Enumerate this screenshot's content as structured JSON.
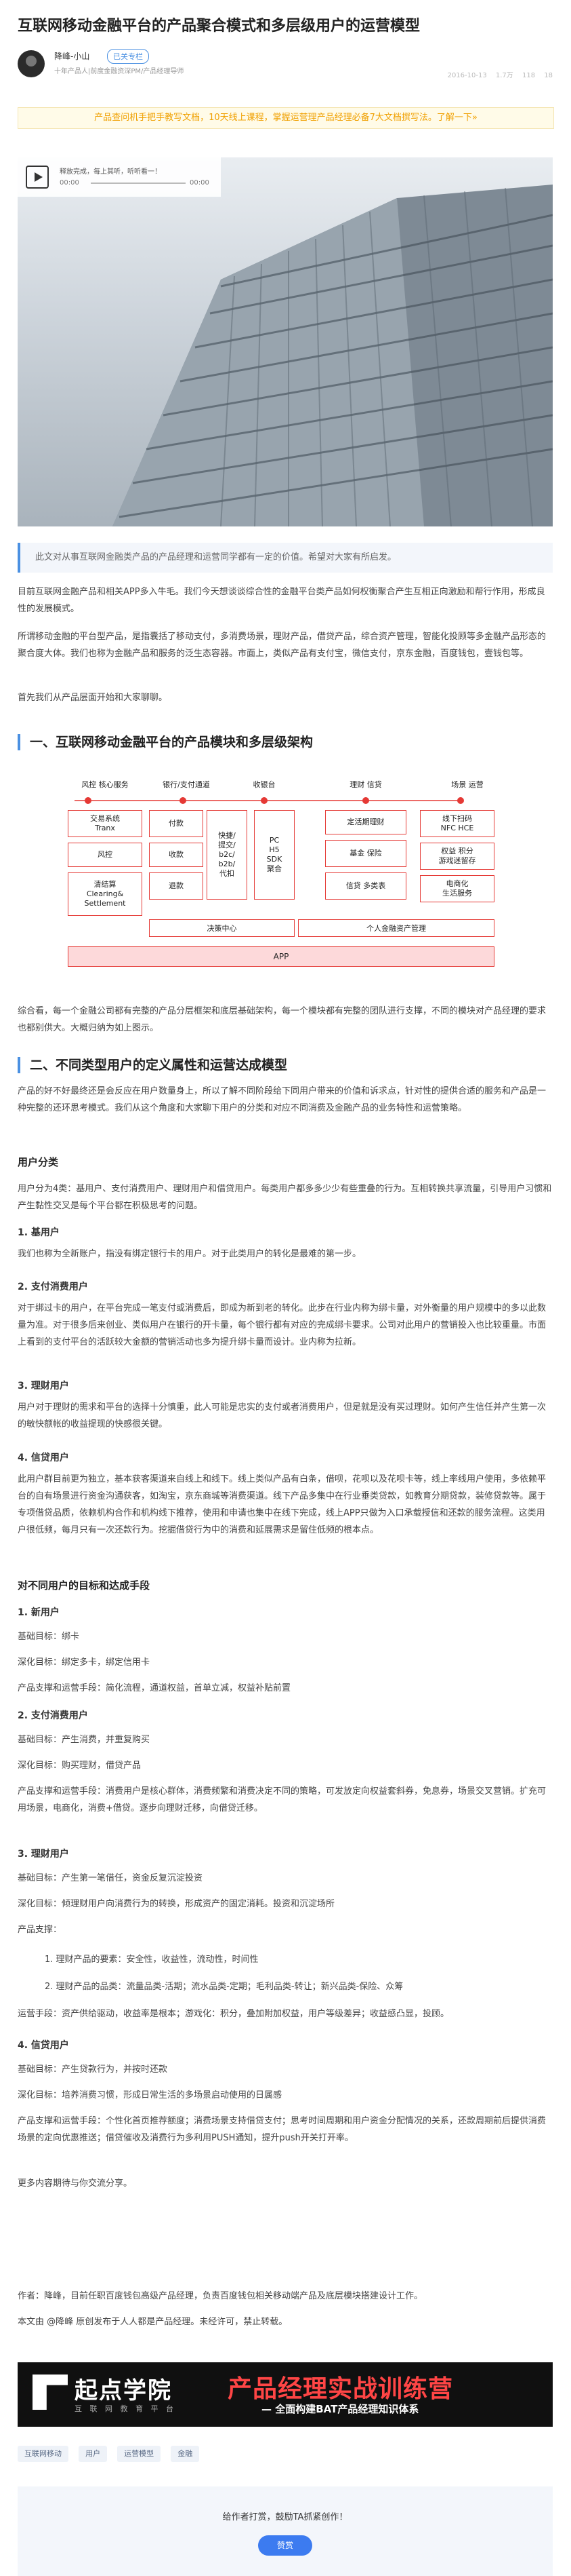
{
  "article": {
    "title": "互联网移动金融平台的产品聚合模式和多层级用户的运营模型",
    "author": "降峰-小山",
    "follow_label": "已关专栏",
    "author_desc": "十年产品人|前度金融资深PM/产品经理导师",
    "date": "2016-10-13",
    "views": "1.7万",
    "likes": "118",
    "comments": "18"
  },
  "notice": "产品查问机手把手教写文档，10天线上课程，掌握运营理产品经理必备7大文档撰写法。了解一下»",
  "audio": {
    "title": "释放完成，每上其听，听听看一！",
    "time_start": "00:00",
    "time_end": "00:00"
  },
  "summary": "此文对从事互联网金融类产品的产品经理和运营同学都有一定的价值。希望对大家有所启发。",
  "intro": [
    "目前互联网金融产品和相关APP多入牛毛。我们今天想谈谈综合性的金融平台类产品如何权衡聚合产生互相正向激励和帮行作用，形成良性的发展模式。",
    "所谓移动金融的平台型产品，是指囊括了移动支付，多消费场景，理财产品，借贷产品，综合资产管理，智能化投顾等多金融产品形态的聚合度大体。我们也称为金融产品和服务的泛生态容器。市面上，类似产品有支付宝，微信支付，京东金融，百度钱包，壹钱包等。",
    "首先我们从产品层面开始和大家聊聊。"
  ],
  "section1": {
    "heading": "一、互联网移动金融平台的产品模块和多层级架构",
    "diagram": {
      "top_labels": [
        "风控 核心服务",
        "银行/支付通道",
        "收银台",
        "理财 信贷",
        "场景 运营"
      ],
      "col1": [
        "交易系统\nTranx",
        "风控",
        "清结算\nClearing&\nSettlement"
      ],
      "col2": [
        "付款",
        "收款",
        "退款"
      ],
      "col3": "快捷/\n提交/\nb2c/\nb2b/\n代扣",
      "col4": "PC\nH5\nSDK\n聚合",
      "col5": [
        "定活期理财",
        "基金 保险",
        "信贷 多类表"
      ],
      "col6": [
        "线下扫码\nNFC HCE",
        "权益 积分\n游戏迷留存",
        "电商化\n生活服务"
      ],
      "bar_left": "决策中心",
      "bar_right": "个人金融资产管理",
      "app": "APP"
    },
    "after": "综合看，每一个金融公司都有完整的产品分层框架和底层基础架构，每一个模块都有完整的团队进行支撑，不同的模块对产品经理的要求也都别供大。大概归纳为如上图示。"
  },
  "section2": {
    "heading": "二、不同类型用户的定义属性和运营达成模型",
    "intro": "产品的好不好最终还是会反应在用户数量身上，所以了解不同阶段给下同用户带来的价值和诉求点，针对性的提供合适的服务和产品是一种完整的还环思考模式。我们从这个角度和大家聊下用户的分类和对应不同消费及金融产品的业务特性和运营策略。",
    "user_class_heading": "用户分类",
    "user_class_intro": "用户分为4类：基用户、支付消费用户、理财用户和借贷用户。每类用户都多多少少有些重叠的行为。互相转换共享流量，引导用户习惯和产生黏性交叉是每个平台都在积极思考的问题。",
    "users": [
      {
        "title": "1. 基用户",
        "text": "我们也称为全新账户，指没有绑定银行卡的用户。对于此类用户的转化是最难的第一步。"
      },
      {
        "title": "2. 支付消费用户",
        "text": "对于绑过卡的用户，在平台完成一笔支付或消费后，即成为新到老的转化。此步在行业内称为绑卡量，对外衡量的用户规模中的多以此数量为准。对于很多后来创业、类似用户在银行的开卡量，每个银行都有对应的完成绑卡要求。公司对此用户的营销投入也比较重量。市面上看到的支付平台的活跃较大金额的营销活动也多为提升绑卡量而设计。业内称为拉新。"
      },
      {
        "title": "3. 理财用户",
        "text": "用户对于理财的需求和平台的选择十分慎重，此人可能是忠实的支付或者消费用户，但是就是没有买过理财。如何产生信任并产生第一次的敏快额帐的收益提现的快感很关键。"
      },
      {
        "title": "4. 信贷用户",
        "text": "此用户群目前更为独立，基本获客渠道来自线上和线下。线上类似产品有白条，借呗，花呗以及花呗卡等，线上率线用户使用，多依赖平台的自有场景进行资金沟通获客，如淘宝，京东商城等消费渠道。线下产品多集中在行业垂类贷款，如教育分期贷款，装修贷款等。属于专项借贷品质，依赖机构合作和机构线下推荐，使用和申请也集中在线下完成，线上APP只做为入口承载授信和还款的服务流程。这类用户很低频，每月只有一次还款行为。挖掘借贷行为中的消费和延展需求是留住低频的根本点。"
      }
    ],
    "goals_heading": "对不同用户的目标和达成手段",
    "goals": [
      {
        "title": "1. 新用户",
        "lines": [
          "基础目标：绑卡",
          "深化目标：绑定多卡，绑定信用卡",
          "产品支撑和运营手段：简化流程，通道权益，首单立减，权益补贴前置"
        ]
      },
      {
        "title": "2. 支付消费用户",
        "lines": [
          "基础目标：产生消费，并重复购买",
          "深化目标：购买理财，借贷产品",
          "产品支撑和运营手段：消费用户是核心群体，消费频繁和消费决定不同的策略，可发放定向权益套斜券，免息券，场景交叉营销。扩充可用场景，电商化，消费+借贷。逐步向理财迁移，向借贷迁移。"
        ]
      },
      {
        "title": "3. 理财用户",
        "lines": [
          "基础目标：产生第一笔借任，资金反复沉淀投资",
          "深化目标：倾理财用户向消费行为的转换，形成资产的固定消耗。投资和沉淀场所"
        ],
        "support_label": "产品支撑：",
        "items": [
          "1. 理财产品的要素：安全性，收益性，流动性，时间性",
          "2. 理财产品的品类：流量品类-活期；流水品类-定期；毛利品类-转让；新兴品类-保险、众筹"
        ],
        "after": "运营手段：资产供给驱动，收益率是根本；游戏化：积分，叠加附加权益，用户等级差异；收益感凸显，投顾。"
      },
      {
        "title": "4. 信贷用户",
        "lines": [
          "基础目标：产生贷款行为，并按时还款",
          "深化目标：培养消费习惯，形成日常生活的多场景启动使用的日属感",
          "产品支撑和运营手段：个性化首页推荐额度；消费场景支持借贷支付；思考时间周期和用户资金分配情况的关系，还款周期前后提供消费场景的定向优惠推送；借贷催收及消费行为多利用PUSH通知，提升push开关打开率。"
        ]
      }
    ],
    "outro": "更多内容期待与你交流分享。"
  },
  "footer": {
    "author_line": "作者：降峰，目前任职百度钱包高级产品经理，负责百度钱包相关移动端产品及底层模块搭建设计工作。",
    "copyright_line": "本文由 @降峰 原创发布于人人都是产品经理。未经许可，禁止转载。"
  },
  "bottom_banner": {
    "brand": "起点学院",
    "brand_sub": "互 联 网 教 育 平 台",
    "slogan": "产品经理实战训练营",
    "slogan_sub": "— 全面构建BAT产品经理知识体系"
  },
  "tags": [
    "互联网移动",
    "用户",
    "运营模型",
    "金融"
  ],
  "reward": {
    "text": "给作者打赏，鼓励TA抓紧创作！",
    "button": "赞赏"
  }
}
